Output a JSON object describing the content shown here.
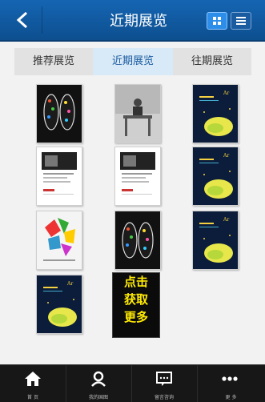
{
  "header": {
    "title": "近期展览",
    "back_icon": "chevron-left-icon",
    "grid_icon": "grid-view-icon",
    "list_icon": "list-view-icon"
  },
  "tabs": [
    {
      "label": "推荐展览",
      "active": false
    },
    {
      "label": "近期展览",
      "active": true
    },
    {
      "label": "往期展览",
      "active": false
    }
  ],
  "promo": {
    "line1": "点击",
    "line2": "获取",
    "line3": "更多"
  },
  "bottom_nav": [
    {
      "label": "首 页",
      "icon": "home-icon"
    },
    {
      "label": "我的国图",
      "icon": "user-icon"
    },
    {
      "label": "留言咨询",
      "icon": "message-icon"
    },
    {
      "label": "更 多",
      "icon": "more-icon"
    }
  ],
  "colors": {
    "header": "#1565b3",
    "accent": "#2c8ee8",
    "promo_text": "#ffea00",
    "bottom_bar": "#171717"
  }
}
